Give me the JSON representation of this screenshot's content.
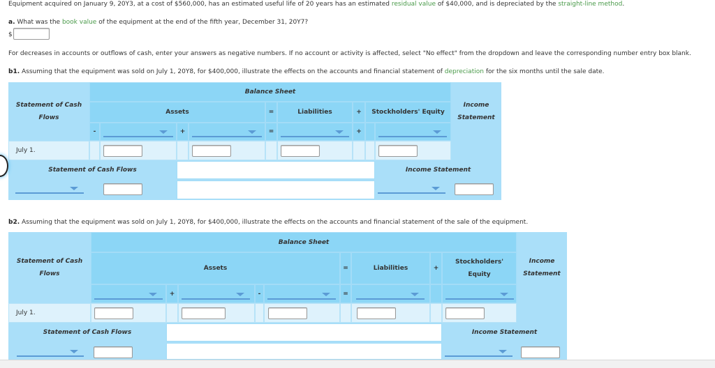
{
  "problem": {
    "intro_parts": [
      "Equipment acquired on January 9, 20Y3, at a cost of $560,000, has an estimated useful life of 20 years has an estimated ",
      "residual value",
      " of $40,000, and is depreciated by the ",
      "straight-line method",
      "."
    ],
    "part_a": {
      "label": "a.",
      "question_parts": [
        "What was the ",
        "book value",
        " of the equipment at the end of the fifth year, December 31, 20Y7?"
      ],
      "currency": "$",
      "answer": ""
    },
    "instructions": "For decreases in accounts or outflows of cash, enter your answers as negative numbers. If no account or activity is affected, select \"No effect\" from the dropdown and leave the corresponding number entry box blank.",
    "part_b1": {
      "label": "b1.",
      "question_parts": [
        "Assuming that the equipment was sold on July 1, 20Y8, for $400,000, illustrate the effects on the accounts and financial statement of ",
        "depreciation",
        " for the six months until the sale date."
      ]
    },
    "part_b2": {
      "label": "b2.",
      "question": "Assuming that the equipment was sold on July 1, 20Y8, for $400,000, illustrate the effects on the accounts and financial statement of the sale of the equipment."
    }
  },
  "table_b1": {
    "scf_header": "Statement of Cash Flows",
    "balance_sheet": "Balance Sheet",
    "assets": "Assets",
    "liabilities": "Liabilities",
    "equity": "Stockholders' Equity",
    "income_header": "Income Statement",
    "ops": {
      "eq": "=",
      "plus": "+",
      "minus": "-"
    },
    "dropdown_ops": [
      "-",
      "+",
      "=",
      "+"
    ],
    "row_label": "July 1.",
    "scf_footer": "Statement of Cash Flows",
    "is_footer": "Income Statement",
    "dropdowns": [
      "",
      "",
      "",
      "",
      "",
      ""
    ],
    "inputs": [
      "",
      "",
      "",
      "",
      "",
      ""
    ]
  },
  "table_b2": {
    "scf_header": "Statement of Cash Flows",
    "balance_sheet": "Balance Sheet",
    "assets": "Assets",
    "liabilities": "Liabilities",
    "equity": "Stockholders' Equity",
    "income_header": "Income Statement",
    "ops": {
      "eq": "=",
      "plus": "+"
    },
    "dropdown_ops": [
      "+",
      "-",
      "=",
      ""
    ],
    "row_label": "July 1.",
    "scf_footer": "Statement of Cash Flows",
    "is_footer": "Income Statement",
    "dropdowns": [
      "",
      "",
      "",
      "",
      "",
      "",
      ""
    ],
    "inputs": [
      "",
      "",
      "",
      "",
      "",
      "",
      ""
    ]
  }
}
